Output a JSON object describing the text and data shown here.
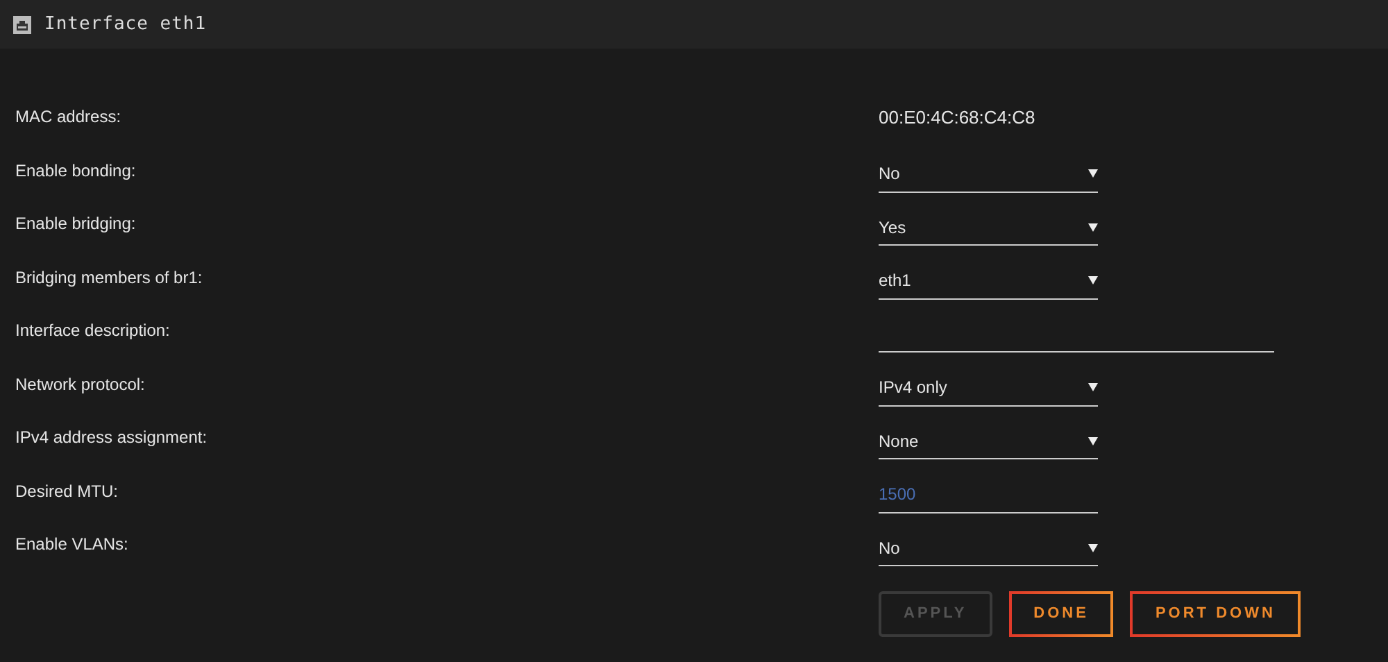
{
  "header": {
    "title": "Interface eth1"
  },
  "fields": [
    {
      "label": "MAC address:",
      "kind": "text",
      "value": "00:E0:4C:68:C4:C8"
    },
    {
      "label": "Enable bonding:",
      "kind": "select",
      "value": "No"
    },
    {
      "label": "Enable bridging:",
      "kind": "select",
      "value": "Yes"
    },
    {
      "label": "Bridging members of br1:",
      "kind": "select",
      "value": "eth1"
    },
    {
      "label": "Interface description:",
      "kind": "input"
    },
    {
      "label": "Network protocol:",
      "kind": "select",
      "value": "IPv4 only"
    },
    {
      "label": "IPv4 address assignment:",
      "kind": "select",
      "value": "None"
    },
    {
      "label": "Desired MTU:",
      "kind": "number",
      "value": "1500"
    },
    {
      "label": "Enable VLANs:",
      "kind": "select",
      "value": "No"
    }
  ],
  "buttons": [
    {
      "label": "APPLY",
      "disabled": true
    },
    {
      "label": "DONE",
      "disabled": false
    },
    {
      "label": "PORT DOWN",
      "disabled": false
    }
  ]
}
